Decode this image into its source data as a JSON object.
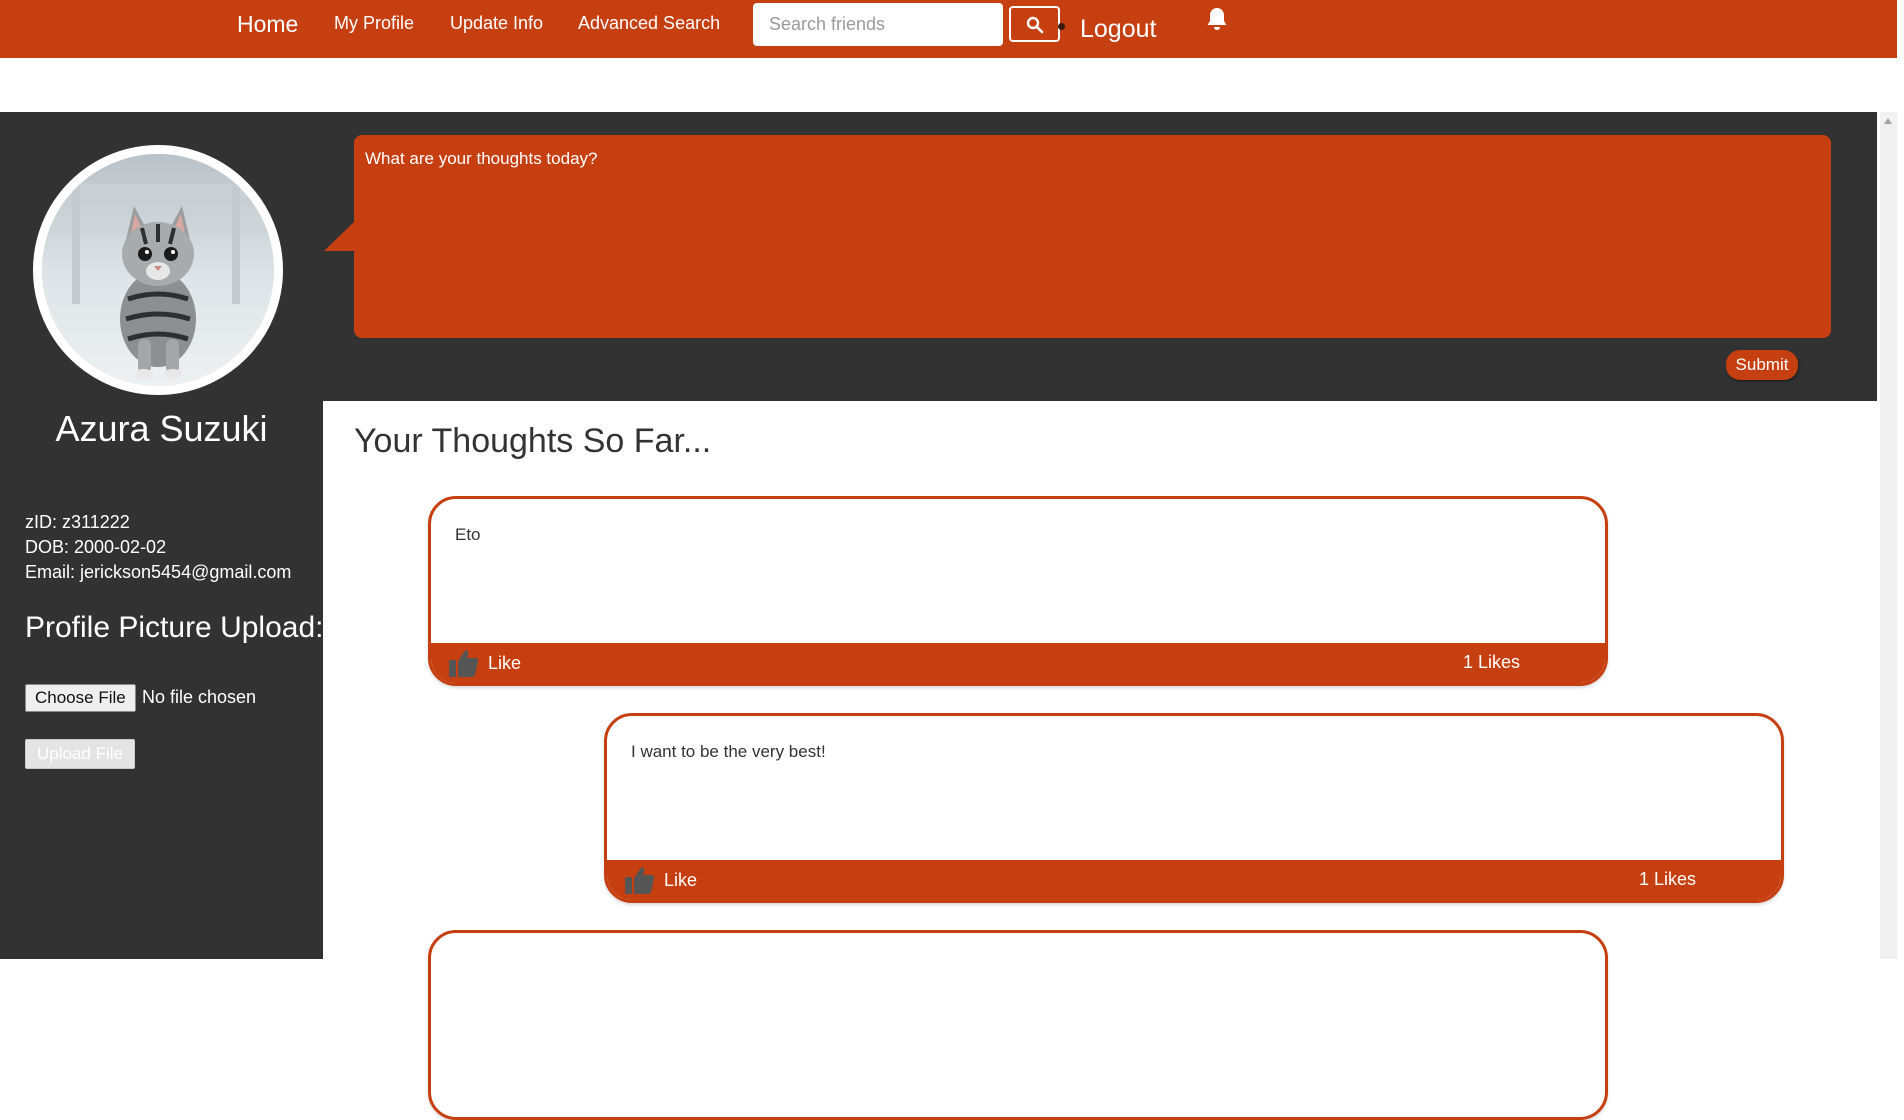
{
  "nav": {
    "home": "Home",
    "my_profile": "My Profile",
    "update_info": "Update Info",
    "advanced_search": "Advanced Search",
    "search_placeholder": "Search friends",
    "logout": "Logout",
    "search_icon": "search-icon",
    "bell_icon": "bell-icon"
  },
  "profile": {
    "name": "Azura Suzuki",
    "zid": "zID: z311222",
    "dob": "DOB: 2000-02-02",
    "email": "Email: jerickson5454@gmail.com",
    "upload_heading": "Profile Picture Upload:",
    "choose_file": "Choose File",
    "file_status": "No file chosen",
    "upload_button": "Upload File"
  },
  "composer": {
    "placeholder": "What are your thoughts today?",
    "submit": "Submit"
  },
  "feed": {
    "heading": "Your Thoughts So Far...",
    "posts": [
      {
        "text": "Eto",
        "like_label": "Like",
        "likes": "1 Likes"
      },
      {
        "text": "I want to be the very best!",
        "like_label": "Like",
        "likes": "1 Likes"
      },
      {
        "text": "",
        "like_label": "",
        "likes": ""
      }
    ]
  },
  "colors": {
    "accent": "#c63f10",
    "dark": "#323232",
    "background": "#ffffff"
  }
}
